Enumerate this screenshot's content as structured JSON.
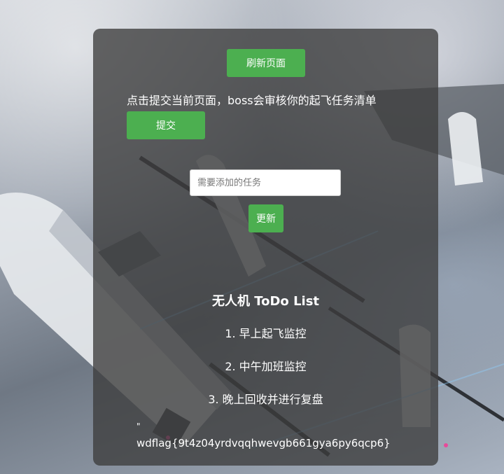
{
  "buttons": {
    "refresh_label": "刷新页面",
    "submit_label": "提交",
    "update_label": "更新"
  },
  "hint_text": "点击提交当前页面，boss会审核你的起飞任务清单",
  "task_input": {
    "placeholder": "需要添加的任务",
    "value": ""
  },
  "todo": {
    "title": "无人机 ToDo List",
    "items": [
      {
        "label": "1. 早上起飞监控"
      },
      {
        "label": "2. 中午加班监控"
      },
      {
        "label": "3. 晚上回收并进行复盘"
      }
    ]
  },
  "output": {
    "quote_mark": "\"",
    "flag_text": "wdflag{9t4z04yrdvqqhwevgb661gya6py6qcp6}"
  },
  "colors": {
    "button_green": "#4caf50",
    "panel_overlay": "#3c3c3c",
    "text": "#ffffff"
  },
  "icons": {
    "background": "drone-missile-photo"
  }
}
